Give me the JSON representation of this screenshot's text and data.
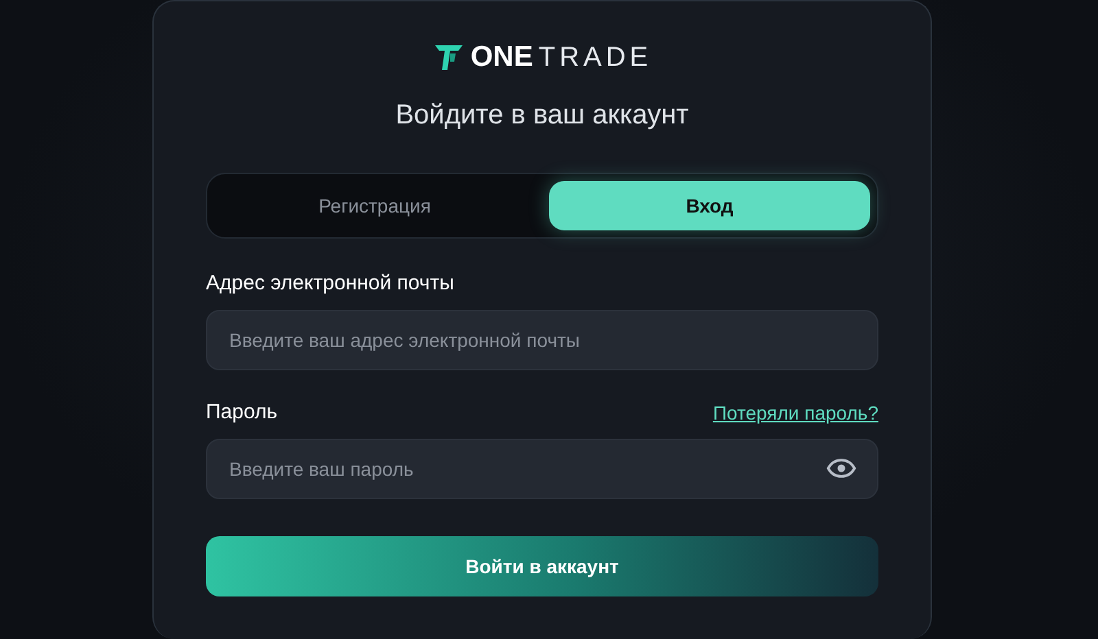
{
  "logo": {
    "bold": "ONE",
    "light": "TRADE"
  },
  "heading": "Войдите в ваш аккаунт",
  "tabs": [
    {
      "label": "Регистрация",
      "selected": false
    },
    {
      "label": "Вход",
      "selected": true
    }
  ],
  "fields": [
    {
      "label": "Адрес электронной почты",
      "placeholder": "Введите ваш адрес электронной почты",
      "kind": "email"
    },
    {
      "label": "Пароль",
      "placeholder": "Введите ваш пароль",
      "kind": "password",
      "link": "Потеряли пароль?"
    }
  ],
  "submit": "Войти в аккаунт"
}
